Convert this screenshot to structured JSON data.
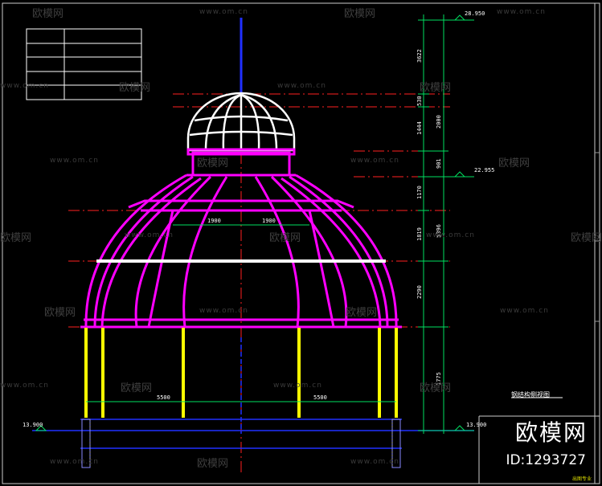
{
  "watermark": {
    "site": "www.om.cn",
    "brand_cn": "欧模网"
  },
  "brand": {
    "name": "欧模网",
    "id": "ID:1293727"
  },
  "drawing": {
    "title": "钢结构侧视图",
    "corner_note": "出图专业"
  },
  "elevations": {
    "top": "28.950",
    "mid": "22.955",
    "base_right": "13.900",
    "base_left": "13.900"
  },
  "dimensions": {
    "vertical_left": [
      "3622",
      "530",
      "1444",
      "901",
      "1170",
      "1819",
      "2290",
      "1775"
    ],
    "vertical_right": [
      "2000",
      "5396"
    ],
    "span_upper": [
      "1900",
      "1900"
    ],
    "span_lower": [
      "5500",
      "5500"
    ]
  },
  "colors": {
    "background": "#000000",
    "dome_top": "#ffffff",
    "dome_main": "#ff00ff",
    "columns": "#ffff00",
    "axis": "#2030ff",
    "gridline": "#ff2020",
    "dimension": "#00e060"
  }
}
